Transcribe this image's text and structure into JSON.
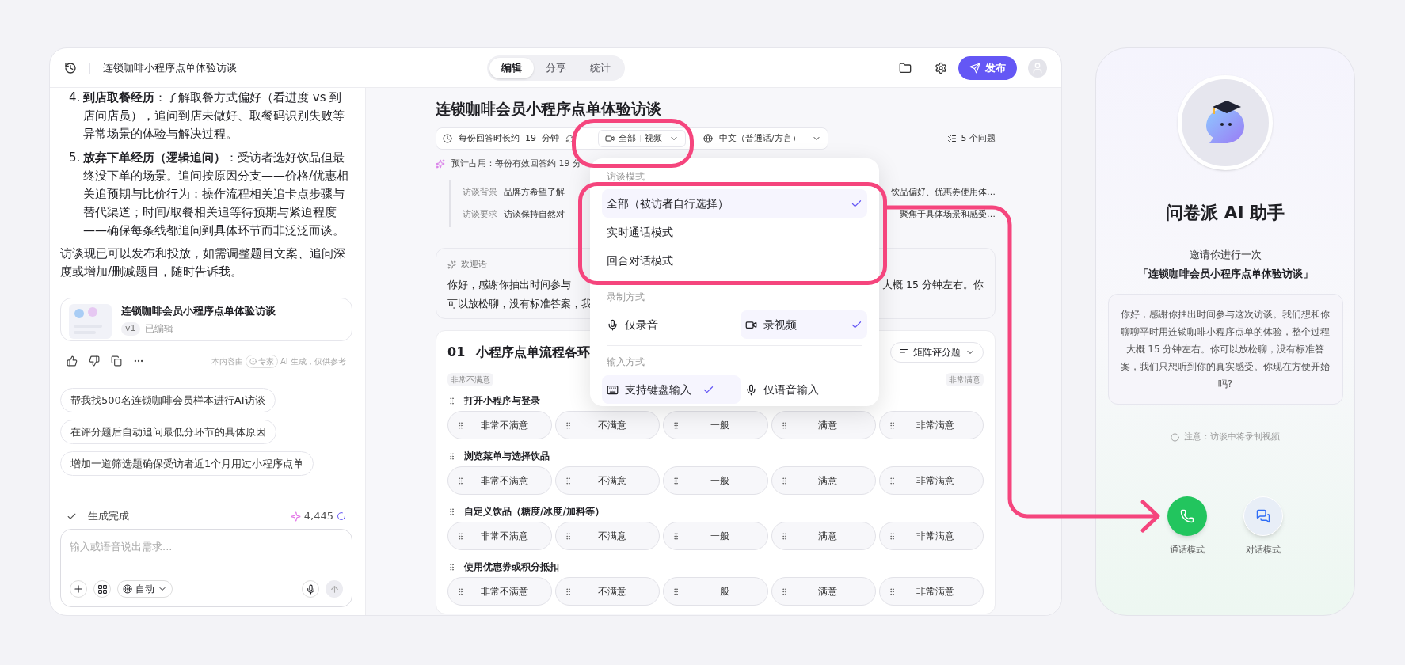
{
  "header": {
    "title": "连锁咖啡小程序点单体验访谈",
    "tabs": [
      {
        "label": "编辑",
        "selected": true
      },
      {
        "label": "分享",
        "selected": false
      },
      {
        "label": "统计",
        "selected": false
      }
    ],
    "publish": "发布"
  },
  "chat": {
    "items": [
      {
        "number": "4.",
        "text": "**到店取餐经历**：了解取餐方式偏好（看进度 vs 到店问店员），追问到店未做好、取餐码识别失败等异常场景的体验与解决过程。"
      },
      {
        "number": "5.",
        "text": "**放弃下单经历（逻辑追问）**：受访者选好饮品但最终没下单的场景。追问按原因分支——价格/优惠相关追预期与比价行为；操作流程相关追卡点步骤与替代渠道；时间/取餐相关追等待预期与紧迫程度——确保每条线都追问到具体环节而非泛泛而谈。"
      }
    ],
    "closing": "访谈现已可以发布和投放，如需调整题目文案、追问深度或增加/删减题目，随时告诉我。",
    "card": {
      "title": "连锁咖啡会员小程序点单体验访谈",
      "version": "v1",
      "status": "已编辑"
    },
    "disclaimer": {
      "before": "本内容由",
      "badge": "专家",
      "after": "AI 生成，仅供参考"
    },
    "suggestions": [
      "帮我找500名连锁咖啡会员样本进行AI访谈",
      "在评分题后自动追问最低分环节的具体原因",
      "增加一道筛选题确保受访者近1个月用过小程序点单"
    ],
    "status": "生成完成",
    "credits": "4,445",
    "input": {
      "placeholder": "输入或语音说出需求...",
      "mode": "自动"
    }
  },
  "survey": {
    "title": "连锁咖啡会员小程序点单体验访谈",
    "duration": "每份回答时长约  19  分钟",
    "mode": {
      "primary": "全部",
      "secondary": "视频"
    },
    "language": "中文（普通话/方言）",
    "question_count": "5 个问题",
    "estimate": "预计占用：每份有效回答约 19 分",
    "details": [
      {
        "label": "访谈背景",
        "text_left": "品牌方希望了解",
        "text_right": "饮品偏好、优惠券使用体…"
      },
      {
        "label": "访谈要求",
        "text_left": "访谈保持自然对",
        "text_right": "聚焦于具体场景和感受…"
      }
    ],
    "welcome": {
      "label": "欢迎语",
      "lines": [
        {
          "left": "你好，感谢你抽出时间参与",
          "right": "大概 15 分钟左右。你"
        },
        {
          "left": "可以放松聊，没有标准答案，我"
        }
      ]
    },
    "question": {
      "number": "01",
      "title": "小程序点单流程各环",
      "type": "矩阵评分题",
      "scale_low": "非常不满意",
      "scale_high": "非常满意",
      "rows": [
        {
          "label": "打开小程序与登录",
          "options": [
            "非常不满意",
            "不满意",
            "一般",
            "满意",
            "非常满意"
          ]
        },
        {
          "label": "浏览菜单与选择饮品",
          "options": [
            "非常不满意",
            "不满意",
            "一般",
            "满意",
            "非常满意"
          ]
        },
        {
          "label": "自定义饮品（糖度/冰度/加料等）",
          "options": [
            "非常不满意",
            "不满意",
            "一般",
            "满意",
            "非常满意"
          ]
        },
        {
          "label": "使用优惠券或积分抵扣",
          "options": [
            "非常不满意",
            "不满意",
            "一般",
            "满意",
            "非常满意"
          ]
        }
      ]
    }
  },
  "dropdown": {
    "sections": [
      {
        "title": "访谈模式",
        "kind": "list",
        "options": [
          {
            "label": "全部（被访者自行选择）",
            "selected": true
          },
          {
            "label": "实时通话模式",
            "selected": false
          },
          {
            "label": "回合对话模式",
            "selected": false
          }
        ]
      },
      {
        "title": "录制方式",
        "kind": "pair",
        "options": [
          {
            "label": "仅录音",
            "selected": false
          },
          {
            "label": "录视频",
            "selected": true
          }
        ]
      },
      {
        "title": "输入方式",
        "kind": "pair",
        "options": [
          {
            "label": "支持键盘输入",
            "selected": true
          },
          {
            "label": "仅语音输入",
            "selected": false
          }
        ]
      }
    ]
  },
  "phone": {
    "title": "问卷派 AI 助手",
    "invite": "邀请你进行一次",
    "survey_name": "「连锁咖啡会员小程序点单体验访谈」",
    "message": "你好，感谢你抽出时间参与这次访谈。我们想和你聊聊平时用连锁咖啡小程序点单的体验，整个过程大概 15 分钟左右。你可以放松聊，没有标准答案，我们只想听到你的真实感受。你现在方便开始吗?",
    "note": "注意：访谈中将录制视频",
    "modes": [
      {
        "label": "通话模式",
        "kind": "call"
      },
      {
        "label": "对话模式",
        "kind": "chat"
      }
    ]
  }
}
